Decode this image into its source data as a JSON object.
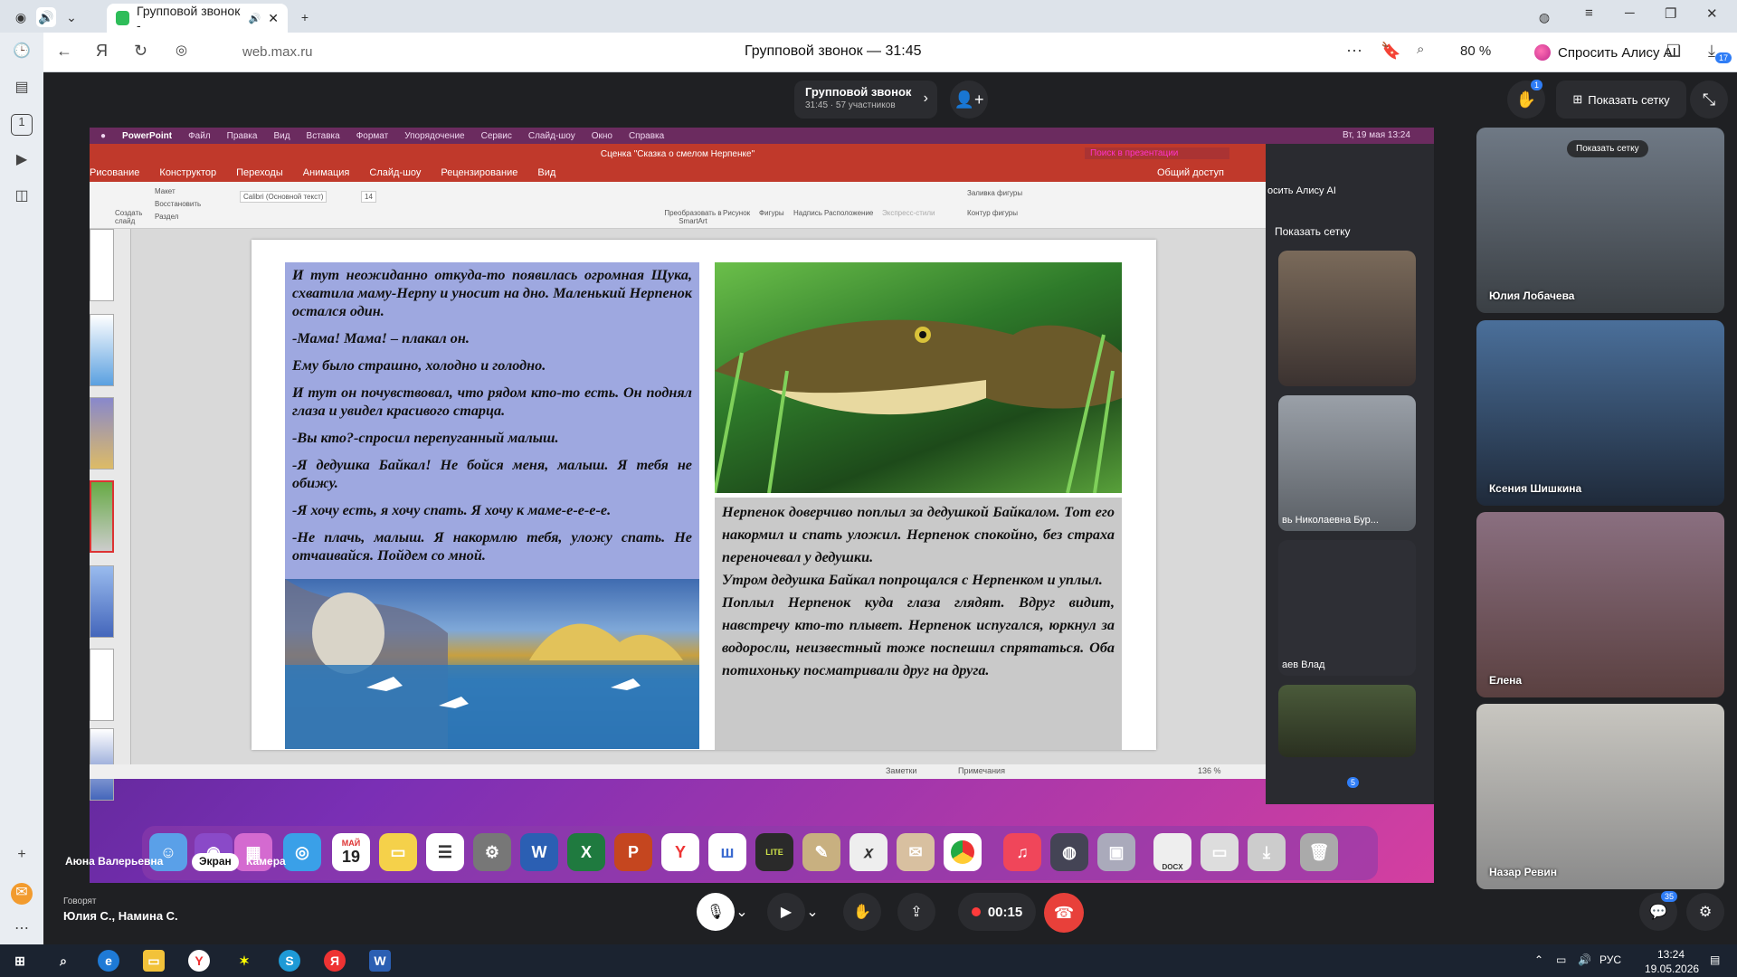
{
  "browser": {
    "tab_title": "Групповой звонок -",
    "url": "web.max.ru",
    "page_title": "Групповой звонок — 31:45",
    "zoom": "80 %",
    "alisa_button": "Спросить Алису AI",
    "downloads_badge": "17"
  },
  "call": {
    "title": "Групповой звонок",
    "subtitle": "31:45 · 57 участников",
    "raise_hand_badge": "1",
    "show_grid": "Показать сетку",
    "presenter_name": "Аюна Валерьевна",
    "screen_button": "Экран",
    "camera_button": "Камера",
    "speaking_label": "Говорят",
    "speaking_names": "Юлия С., Намина С.",
    "record_time": "00:15",
    "chat_badge": "35"
  },
  "shared_screen": {
    "mac_menu": [
      "PowerPoint",
      "Файл",
      "Правка",
      "Вид",
      "Вставка",
      "Формат",
      "Упорядочение",
      "Сервис",
      "Слайд-шоу",
      "Окно",
      "Справка"
    ],
    "mac_clock": "Вт, 19 мая 13:24",
    "doc_title": "Сценка \"Сказка о смелом Нерпенке\"",
    "search_placeholder": "Поиск в презентации",
    "share_label": "Общий доступ",
    "ribbon_tabs": [
      "Рисование",
      "Конструктор",
      "Переходы",
      "Анимация",
      "Слайд-шоу",
      "Рецензирование",
      "Вид"
    ],
    "ribbon": {
      "create_slide": "Создать слайд",
      "layout": "Макет",
      "restore": "Восстановить",
      "section": "Раздел",
      "font": "Calibri (Основной текст)",
      "size": "14",
      "smartart": "Преобразовать в SmartArt",
      "picture": "Рисунок",
      "shapes": "Фигуры",
      "textbox": "Надпись",
      "arrange": "Расположение",
      "styles": "Экспресс-стили",
      "fill": "Заливка фигуры",
      "outline": "Контур фигуры"
    },
    "slide_text_left": [
      "И тут неожиданно откуда-то появилась огромная Щука, схватила маму-Нерпу и уносит на дно. Маленький Нерпенок остался один.",
      "-Мама! Мама! – плакал он.",
      "Ему было страшно, холодно и голодно.",
      "И тут он почувствовал, что рядом кто-то есть. Он поднял глаза и увидел красивого старца.",
      "-Вы кто?-спросил перепуганный малыш.",
      "-Я дедушка Байкал! Не бойся меня, малыш. Я тебя не обижу.",
      "-Я хочу есть, я хочу спать. Я хочу к маме-е-е-е-е.",
      "-Не плачь, малыш. Я накормлю тебя, уложу спать. Не отчаивайся. Пойдем со мной."
    ],
    "slide_text_right": [
      "Нерпенок доверчиво поплыл за дедушкой Байкалом. Тот его накормил и спать уложил. Нерпенок спокойно, без страха переночевал у дедушки.",
      "Утром дедушка Байкал попрощался с Нерпенком и уплыл.",
      "Поплыл Нерпенок куда глаза глядят. Вдруг видит, навстречу кто-то плывет. Нерпенок испугался, юркнул за водоросли, неизвестный тоже поспешил спрятаться. Оба потихоньку посматривали друг на друга."
    ],
    "status_notes": "Заметки",
    "status_comments": "Примечания",
    "status_zoom": "136 %",
    "inner_alisa": "осить Алису AI",
    "inner_grid": "Показать сетку",
    "inner_names": [
      "вь Николаевна Бур...",
      "аев Влад"
    ],
    "dock_date_month": "МАЙ",
    "dock_date_day": "19",
    "dock_lite": "LITE",
    "dock_docx": "DOCX",
    "inner_badge": "5"
  },
  "participants": [
    {
      "name": "Юлия Лобачева",
      "top_label": "Показать сетку"
    },
    {
      "name": "Ксения Шишкина"
    },
    {
      "name": "Елена"
    },
    {
      "name": "Назар Ревин"
    }
  ],
  "taskbar": {
    "lang": "РУС",
    "time": "13:24",
    "date": "19.05.2026"
  },
  "colors": {
    "ppt_red": "#c0392b",
    "slide_blue": "#9ea8e0",
    "hangup_red": "#e8403a"
  }
}
